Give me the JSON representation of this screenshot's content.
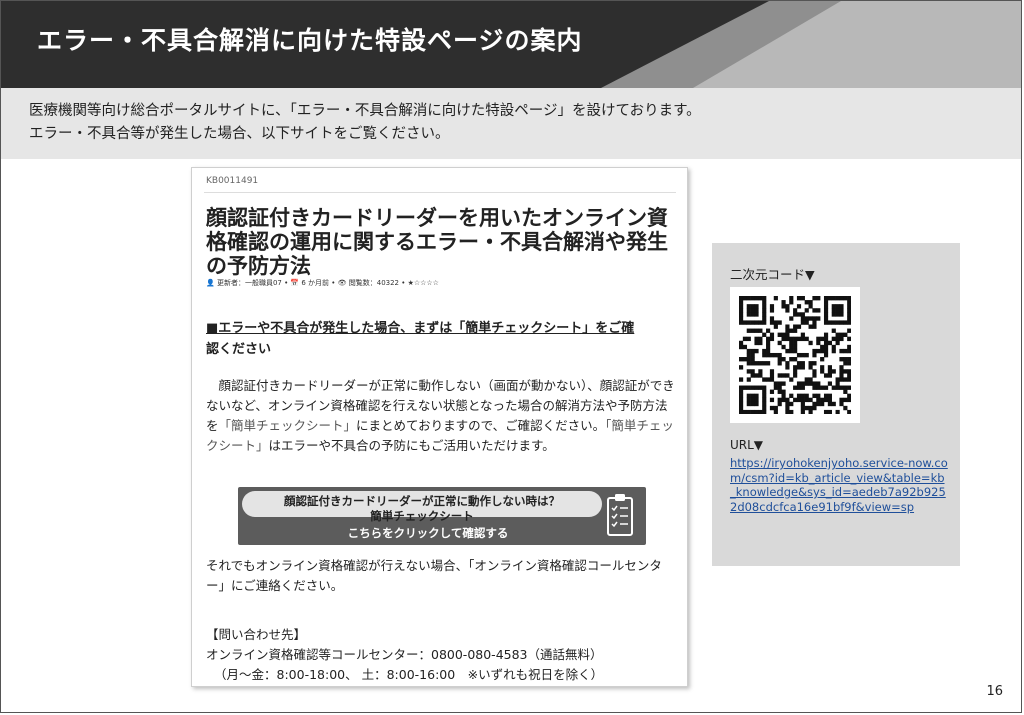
{
  "header": {
    "title": "エラー・不具合解消に向けた特設ページの案内"
  },
  "intro": {
    "line1": "医療機関等向け総合ポータルサイトに、「エラー・不具合解消に向けた特設ページ」を設けております。",
    "line2": "エラー・不具合等が発生した場合、以下サイトをご覧ください。"
  },
  "article": {
    "kb_id": "KB0011491",
    "title": "顔認証付きカードリーダーを用いたオンライン資格確認の運用に関するエラー・不具合解消や発生の予防方法",
    "meta": "👤 更新者：一般職員07 • 📅 6 か月前 • 👁 閲覧数：40322 • ★☆☆☆☆",
    "section_head_underlined": "■エラーや不具合が発生した場合、まずは「簡単チェックシート」をご確",
    "section_head_rest": "認ください",
    "body_part1": "　顔認証付きカードリーダーが正常に動作しない（画面が動かない）、顔認証ができないなど、オンライン資格確認を行えない状態となった場合の解消方法や予防方法を",
    "body_hl1": "「簡単チェックシート」",
    "body_part2": "にまとめておりますので、ご確認ください。",
    "body_hl2": "「簡単チェックシート」",
    "body_part3": "はエラーや不具合の予防にもご活用いただけます。",
    "cta_line1": "顔認証付きカードリーダーが正常に動作しない時は？",
    "cta_line2": "簡単チェックシート",
    "cta_line3": "こちらをクリックして確認する",
    "after_text": "それでもオンライン資格確認が行えない場合、「オンライン資格確認コールセンター」にご連絡ください。",
    "contact_head": "【問い合わせ先】",
    "contact_line1": "オンライン資格確認等コールセンター：0800-080-4583（通話無料）",
    "contact_line2": "（月～金：8:00-18:00、 土：8:00-16:00　※いずれも祝日を除く）"
  },
  "side": {
    "qr_label": "二次元コード▼",
    "url_label": "URL▼",
    "url": "https://iryohokenjyoho.service-now.com/csm?id=kb_article_view&table=kb_knowledge&sys_id=aedeb7a92b9252d08cdcfca16e91bf9f&view=sp"
  },
  "page_number": "16"
}
